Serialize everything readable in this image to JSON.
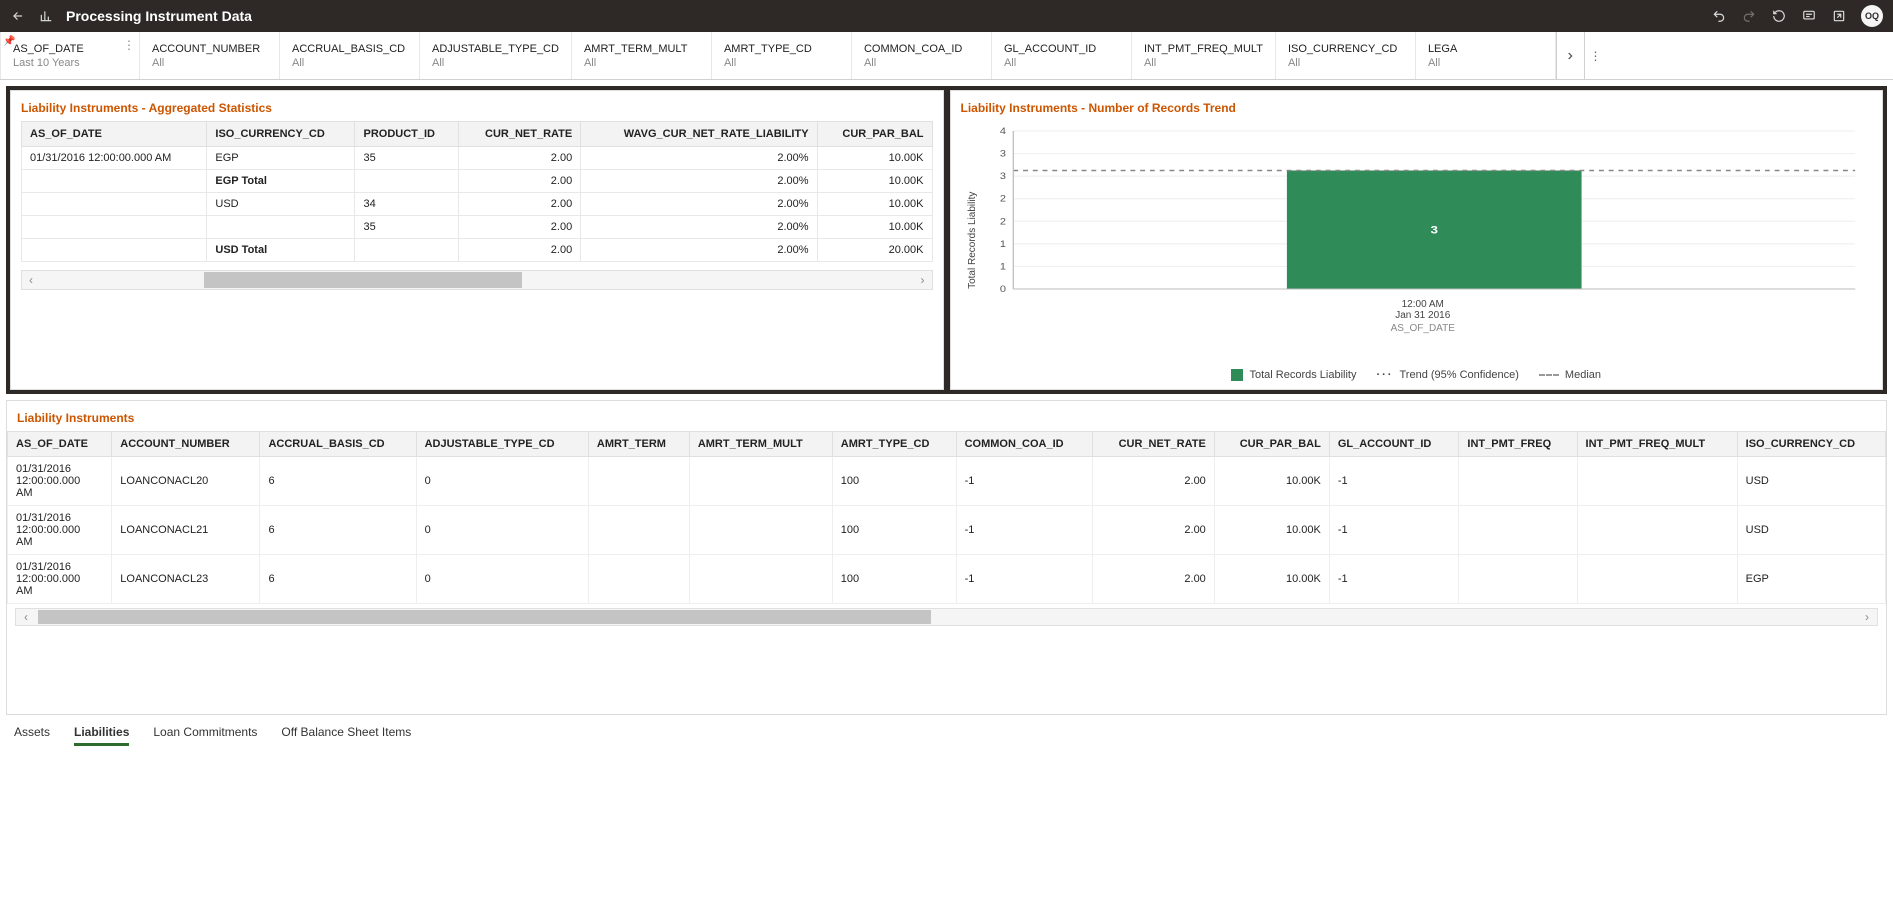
{
  "header": {
    "title": "Processing Instrument Data",
    "avatar_initials": "OQ"
  },
  "filters": [
    {
      "name": "AS_OF_DATE",
      "value": "Last 10 Years",
      "pinned": true,
      "menu": true
    },
    {
      "name": "ACCOUNT_NUMBER",
      "value": "All"
    },
    {
      "name": "ACCRUAL_BASIS_CD",
      "value": "All"
    },
    {
      "name": "ADJUSTABLE_TYPE_CD",
      "value": "All"
    },
    {
      "name": "AMRT_TERM_MULT",
      "value": "All"
    },
    {
      "name": "AMRT_TYPE_CD",
      "value": "All"
    },
    {
      "name": "COMMON_COA_ID",
      "value": "All"
    },
    {
      "name": "GL_ACCOUNT_ID",
      "value": "All"
    },
    {
      "name": "INT_PMT_FREQ_MULT",
      "value": "All"
    },
    {
      "name": "ISO_CURRENCY_CD",
      "value": "All"
    },
    {
      "name": "LEGA",
      "value": "All",
      "truncated": true
    }
  ],
  "agg_panel": {
    "title": "Liability Instruments - Aggregated Statistics",
    "columns": [
      "AS_OF_DATE",
      "ISO_CURRENCY_CD",
      "PRODUCT_ID",
      "CUR_NET_RATE",
      "WAVG_CUR_NET_RATE_LIABILITY",
      "CUR_PAR_BAL"
    ],
    "rows": [
      {
        "as_of": "01/31/2016 12:00:00.000 AM",
        "iso": "EGP",
        "product": "35",
        "rate": "2.00",
        "wavg": "2.00%",
        "par": "10.00K"
      },
      {
        "as_of": "",
        "iso": "EGP Total",
        "iso_bold": true,
        "product": "",
        "rate": "2.00",
        "wavg": "2.00%",
        "par": "10.00K"
      },
      {
        "as_of": "",
        "iso": "USD",
        "product": "34",
        "rate": "2.00",
        "wavg": "2.00%",
        "par": "10.00K"
      },
      {
        "as_of": "",
        "iso": "",
        "product": "35",
        "rate": "2.00",
        "wavg": "2.00%",
        "par": "10.00K"
      },
      {
        "as_of": "",
        "iso": "USD Total",
        "iso_bold": true,
        "product": "",
        "rate": "2.00",
        "wavg": "2.00%",
        "par": "20.00K"
      }
    ]
  },
  "chart_panel": {
    "title": "Liability Instruments - Number of Records Trend",
    "legend": {
      "series": "Total Records Liability",
      "trend": "Trend (95% Confidence)",
      "median": "Median"
    },
    "xaxis_title": "AS_OF_DATE",
    "yaxis_title": "Total Records Liability",
    "xlabel_line1": "12:00 AM",
    "xlabel_line2": "Jan 31 2016"
  },
  "chart_data": {
    "type": "bar",
    "categories": [
      "12:00 AM Jan 31 2016"
    ],
    "series": [
      {
        "name": "Total Records Liability",
        "values": [
          3
        ]
      }
    ],
    "median": 3,
    "ylim": [
      0,
      4
    ],
    "yticks": [
      0,
      1,
      1,
      2,
      2,
      3,
      3,
      4
    ],
    "xlabel": "AS_OF_DATE",
    "ylabel": "Total Records Liability",
    "bar_label": "3",
    "bar_color": "#2f8b57"
  },
  "detail_panel": {
    "title": "Liability Instruments",
    "columns": [
      "AS_OF_DATE",
      "ACCOUNT_NUMBER",
      "ACCRUAL_BASIS_CD",
      "ADJUSTABLE_TYPE_CD",
      "AMRT_TERM",
      "AMRT_TERM_MULT",
      "AMRT_TYPE_CD",
      "COMMON_COA_ID",
      "CUR_NET_RATE",
      "CUR_PAR_BAL",
      "GL_ACCOUNT_ID",
      "INT_PMT_FREQ",
      "INT_PMT_FREQ_MULT",
      "ISO_CURRENCY_CD"
    ],
    "rows": [
      {
        "as_of": "01/31/2016 12:00:00.000 AM",
        "acct": "LOANCONACL20",
        "accrual": "6",
        "adj": "0",
        "amrt_term": "",
        "amrt_term_mult": "",
        "amrt_type": "100",
        "coa": "-1",
        "rate": "2.00",
        "par": "10.00K",
        "gl": "-1",
        "freq": "",
        "freq_mult": "",
        "iso": "USD"
      },
      {
        "as_of": "01/31/2016 12:00:00.000 AM",
        "acct": "LOANCONACL21",
        "accrual": "6",
        "adj": "0",
        "amrt_term": "",
        "amrt_term_mult": "",
        "amrt_type": "100",
        "coa": "-1",
        "rate": "2.00",
        "par": "10.00K",
        "gl": "-1",
        "freq": "",
        "freq_mult": "",
        "iso": "USD"
      },
      {
        "as_of": "01/31/2016 12:00:00.000 AM",
        "acct": "LOANCONACL23",
        "accrual": "6",
        "adj": "0",
        "amrt_term": "",
        "amrt_term_mult": "",
        "amrt_type": "100",
        "coa": "-1",
        "rate": "2.00",
        "par": "10.00K",
        "gl": "-1",
        "freq": "",
        "freq_mult": "",
        "iso": "EGP"
      }
    ]
  },
  "tabs": [
    {
      "label": "Assets",
      "active": false
    },
    {
      "label": "Liabilities",
      "active": true
    },
    {
      "label": "Loan Commitments",
      "active": false
    },
    {
      "label": "Off Balance Sheet Items",
      "active": false
    }
  ]
}
